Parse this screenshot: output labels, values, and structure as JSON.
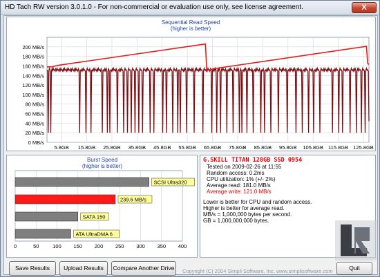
{
  "window": {
    "title": "HD Tach RW version 3.0.1.0  - For non-commercial or evaluation use only, see license agreement.",
    "close_label": "X"
  },
  "chart_data": [
    {
      "type": "line",
      "title": "Sequential Read Speed",
      "subtitle": "(higher is better)",
      "ylabel_unit": "MB/s",
      "ylim": [
        0,
        220
      ],
      "y_ticks": [
        "0 MB/s",
        "20 MB/s",
        "40 MB/s",
        "60 MB/s",
        "80 MB/s",
        "100 MB/s",
        "120 MB/s",
        "140 MB/s",
        "160 MB/s",
        "180 MB/s",
        "200 MB/s"
      ],
      "y_tick_values": [
        0,
        20,
        40,
        60,
        80,
        100,
        120,
        140,
        160,
        180,
        200
      ],
      "x_ticks": [
        "5.8GB",
        "15.8GB",
        "25.8GB",
        "35.8GB",
        "45.8GB",
        "55.8GB",
        "65.8GB",
        "75.8GB",
        "85.8GB",
        "95.8GB",
        "105.8GB",
        "115.8GB",
        "125.8GB"
      ],
      "x_tick_values": [
        5.8,
        15.8,
        25.8,
        35.8,
        45.8,
        55.8,
        65.8,
        75.8,
        85.8,
        95.8,
        105.8,
        115.8,
        125.8
      ],
      "xlim": [
        0,
        128
      ],
      "grid": true,
      "series": [
        {
          "color": "#e41b1b",
          "points": [
            [
              0,
              158
            ],
            [
              2,
              158
            ],
            [
              4,
              161
            ],
            [
              63,
              206
            ],
            [
              63.5,
              152
            ],
            [
              64.5,
              151
            ],
            [
              66,
              154
            ],
            [
              127,
              201
            ],
            [
              127.5,
              165
            ],
            [
              128,
              163
            ]
          ]
        },
        {
          "color": "#7a0f14",
          "baseline": 152,
          "low": 20,
          "dip_positions": [
            0.5,
            1.5,
            13.0,
            15.5,
            17.5,
            22.0,
            24.0,
            25.0,
            28.0,
            30.5,
            32.0,
            33.5,
            35.0,
            36.5,
            38.0,
            41.0,
            42.5,
            46.0,
            47.5,
            50.0,
            52.0,
            53.0,
            55.5,
            58.5,
            62.0,
            65.5,
            67.5,
            69.0,
            71.5,
            74.0,
            76.5,
            77.5,
            79.5,
            82.0,
            85.0,
            86.5,
            89.0,
            92.0,
            95.5,
            99.0,
            101.5,
            104.0,
            106.0,
            108.5,
            113.5,
            116.0,
            117.5,
            120.5,
            123.0,
            125.0,
            126.5
          ]
        }
      ]
    },
    {
      "type": "bar",
      "orientation": "horizontal",
      "title": "Burst Speed",
      "subtitle": "(higher is better)",
      "xlim": [
        0,
        400
      ],
      "x_ticks": [
        "0",
        "50",
        "100",
        "150",
        "200",
        "250",
        "300",
        "350",
        "400"
      ],
      "x_tick_values": [
        0,
        50,
        100,
        150,
        200,
        250,
        300,
        350,
        400
      ],
      "bars": [
        {
          "label": "SCSI Ultra320",
          "value": 320,
          "color": "#7f7f7f"
        },
        {
          "label": "239.6 MB/s",
          "value": 239.6,
          "color": "#ff1a1a"
        },
        {
          "label": "SATA 150",
          "value": 150,
          "color": "#7f7f7f"
        },
        {
          "label": "ATA UltraDMA 6",
          "value": 133,
          "color": "#7f7f7f"
        }
      ]
    }
  ],
  "info": {
    "drive_name": "G.SKILL TITAN 128GB SSD 0954",
    "tested_on": "Tested on 2009-02-26 at 11:55",
    "random_access": "Random access: 0.2ms",
    "cpu_utilization": "CPU utilization: 1% (+/- 2%)",
    "average_read": "Average read: 181.0 MB/s",
    "average_write": "Average write: 121.0 MB/s",
    "notes": [
      "Lower is better for CPU and random access.",
      "Higher is better for average read.",
      "MB/s = 1,000,000 bytes per second.",
      "GB = 1,000,000,000 bytes."
    ],
    "write_color": "#e00000"
  },
  "buttons": {
    "save_results": "Save Results",
    "upload_results": "Upload Results",
    "compare_drive": "Compare Another Drive",
    "quit": "Quit"
  },
  "footer": {
    "copyright": "Copyright (C) 2004 Simpli Software, Inc. www.simplisoftware.com"
  },
  "logo": {
    "text": "Legit Reviews"
  }
}
